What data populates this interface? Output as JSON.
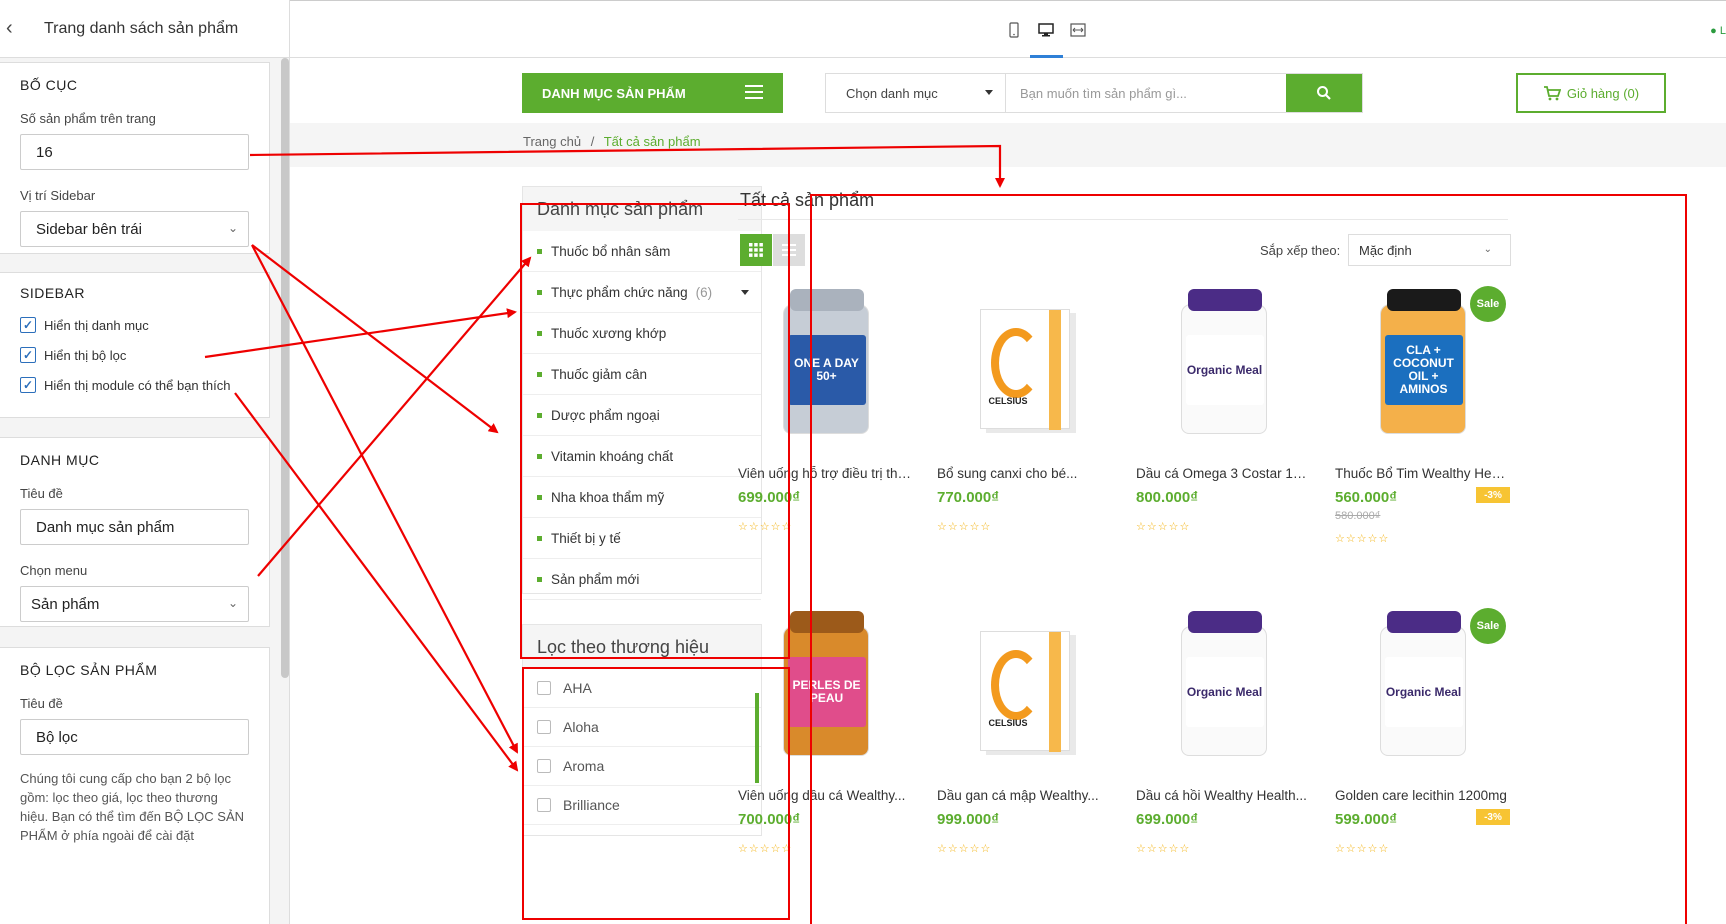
{
  "panel": {
    "title": "Trang danh sách sản phẩm",
    "layout": {
      "heading": "BỐ CỤC",
      "per_page_label": "Số sản phẩm trên trang",
      "per_page_value": "16",
      "sidebar_pos_label": "Vị trí Sidebar",
      "sidebar_pos_value": "Sidebar bên trái"
    },
    "sidebar": {
      "heading": "SIDEBAR",
      "options": [
        "Hiển thị danh mục",
        "Hiển thị bộ lọc",
        "Hiển thị module có thể bạn thích"
      ]
    },
    "category": {
      "heading": "DANH MỤC",
      "title_label": "Tiêu đề",
      "title_value": "Danh mục sản phẩm",
      "menu_label": "Chọn menu",
      "menu_value": "Sản phẩm"
    },
    "filter": {
      "heading": "BỘ LỌC SẢN PHẨM",
      "title_label": "Tiêu đề",
      "title_value": "Bộ lọc",
      "description": "Chúng tôi cung cấp cho bạn 2 bộ lọc gồm: lọc theo giá, lọc theo thương hiệu. Bạn có thể tìm đến BỘ LỌC SẢN PHẨM ở phía ngoài để cài đặt"
    }
  },
  "topbar": {
    "status_text": "L"
  },
  "store": {
    "category_button": "DANH MỤC SẢN PHẨM",
    "search_category": "Chọn danh mục",
    "search_placeholder": "Bạn muốn tìm sản phẩm gì...",
    "cart": "Giỏ hàng (0)",
    "breadcrumb": {
      "home": "Trang chủ",
      "sep": "/",
      "current": "Tất cả sản phẩm"
    },
    "categories_widget": {
      "title": "Danh mục sản phẩm",
      "items": [
        {
          "label": "Thuốc bổ nhân sâm"
        },
        {
          "label": "Thực phẩm chức năng",
          "count": "(6)"
        },
        {
          "label": "Thuốc xương khớp"
        },
        {
          "label": "Thuốc giảm cân"
        },
        {
          "label": "Dược phẩm ngoại"
        },
        {
          "label": "Vitamin khoáng chất"
        },
        {
          "label": "Nha khoa thẩm mỹ"
        },
        {
          "label": "Thiết bị y tế"
        },
        {
          "label": "Sản phẩm mới"
        }
      ]
    },
    "brand_widget": {
      "title": "Lọc theo thương hiệu",
      "items": [
        "AHA",
        "Aloha",
        "Aroma",
        "Brilliance"
      ]
    },
    "main": {
      "title": "Tất cả sản phẩm",
      "sort_label": "Sắp xếp theo:",
      "sort_value": "Mặc định",
      "products": [
        {
          "name": "Viên uống hỗ trợ điều trị tho...",
          "price": "699.000₫",
          "img_text": "ONE A DAY 50+",
          "kind": "bottle-blue"
        },
        {
          "name": "Bổ sung canxi cho bé...",
          "price": "770.000₫",
          "img_text": "CELSIUS",
          "kind": "box"
        },
        {
          "name": "Dầu cá Omega 3 Costar 100...",
          "price": "800.000₫",
          "img_text": "Organic Meal",
          "kind": "bottle-organic"
        },
        {
          "name": "Thuốc Bổ Tim Wealthy Healt...",
          "price": "560.000₫",
          "old_price": "580.000₫",
          "sale": "Sale",
          "discount": "-3%",
          "img_text": "CLA + COCONUT OIL + AMINOS",
          "kind": "bottle-bpi"
        },
        {
          "name": "Viên uống dầu cá Wealthy...",
          "price": "700.000₫",
          "img_text": "PERLES DE PEAU",
          "kind": "bottle-perles"
        },
        {
          "name": "Dầu gan cá mập Wealthy...",
          "price": "999.000₫",
          "img_text": "CELSIUS",
          "kind": "box"
        },
        {
          "name": "Dầu cá hồi Wealthy Health...",
          "price": "699.000₫",
          "img_text": "Organic Meal",
          "kind": "bottle-organic"
        },
        {
          "name": "Golden care lecithin 1200mg",
          "price": "599.000₫",
          "sale": "Sale",
          "discount": "-3%",
          "img_text": "Organic Meal",
          "kind": "bottle-organic"
        }
      ]
    }
  },
  "colors": {
    "accent": "#5cad2f",
    "annotation": "#e00000",
    "star": "#f3b10c",
    "discount": "#f7c433"
  }
}
